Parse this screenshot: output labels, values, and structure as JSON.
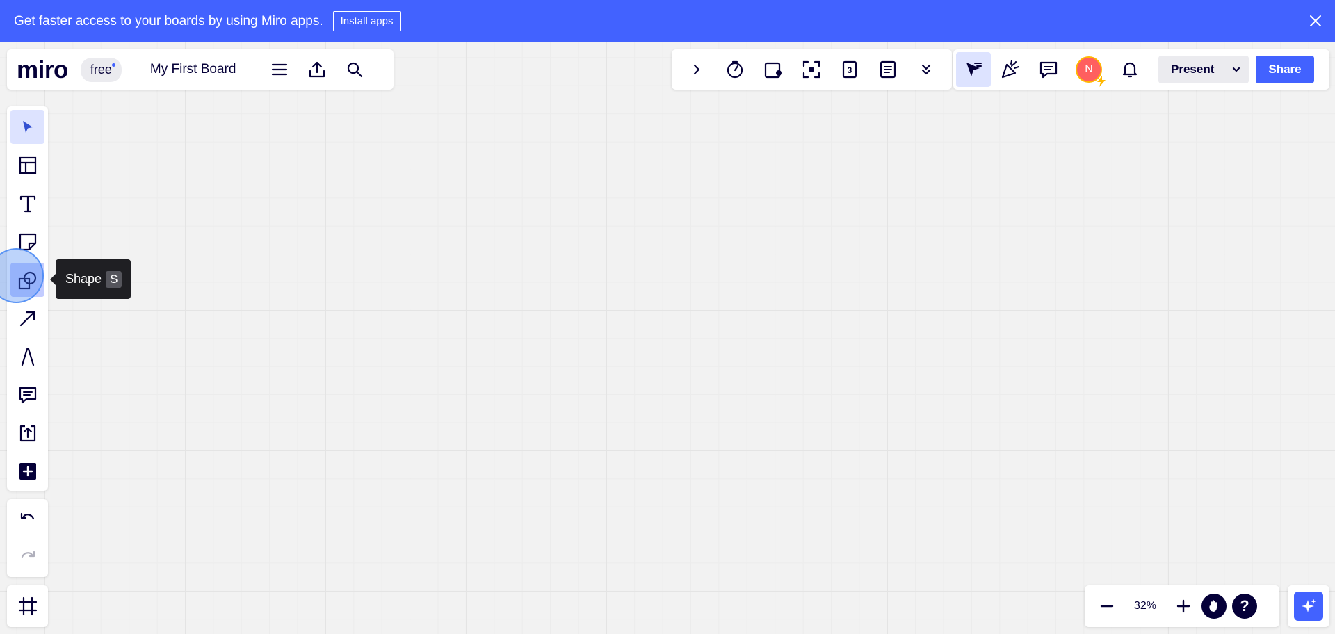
{
  "banner": {
    "text": "Get faster access to your boards by using Miro apps.",
    "install_label": "Install apps"
  },
  "header": {
    "logo": "miro",
    "plan": "free",
    "board_title": "My First Board",
    "icons": [
      "menu-icon",
      "export-icon",
      "search-icon"
    ]
  },
  "tools_bar": {
    "icons": [
      "chevron-right-icon",
      "timer-icon",
      "voting-icon",
      "focus-icon",
      "countdown-icon",
      "notes-icon",
      "double-chevron-down-icon"
    ]
  },
  "collab": {
    "avatar_initial": "N",
    "present_label": "Present",
    "share_label": "Share"
  },
  "left_toolbar": {
    "tools": [
      "select",
      "templates",
      "text",
      "sticky-note",
      "shape",
      "connection-line",
      "pen",
      "comment",
      "upload",
      "more-apps"
    ],
    "selected": "select",
    "hovered": "shape"
  },
  "tooltip": {
    "label": "Shape",
    "shortcut": "S"
  },
  "zoom": {
    "level": "32%"
  },
  "colors": {
    "brand": "#4262ff",
    "ink": "#050038",
    "canvas": "#f2f2f2"
  }
}
